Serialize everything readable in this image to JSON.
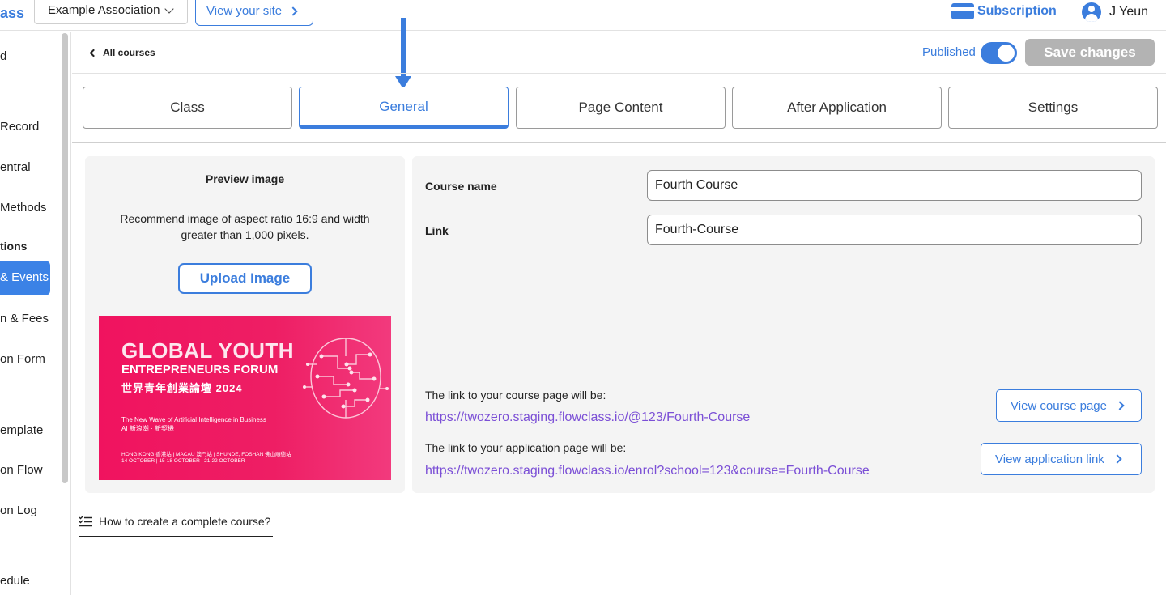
{
  "topbar": {
    "brand_fragment": "ass",
    "association": "Example Association",
    "view_site": "View your site",
    "subscription": "Subscription",
    "user_name": "J Yeun"
  },
  "sidebar": {
    "items": [
      {
        "label": "d"
      },
      {
        "label": "Record"
      },
      {
        "label": "entral"
      },
      {
        "label": "Methods"
      },
      {
        "label": "tions"
      },
      {
        "label": "& Events"
      },
      {
        "label": "n & Fees"
      },
      {
        "label": "on Form"
      },
      {
        "label": "emplate"
      },
      {
        "label": "on Flow"
      },
      {
        "label": "on Log"
      },
      {
        "label": "edule"
      }
    ]
  },
  "header": {
    "back_label": "All courses",
    "published_label": "Published",
    "published_on": true,
    "save_label": "Save changes"
  },
  "tabs": [
    {
      "label": "Class"
    },
    {
      "label": "General"
    },
    {
      "label": "Page Content"
    },
    {
      "label": "After Application"
    },
    {
      "label": "Settings"
    }
  ],
  "active_tab": "General",
  "preview": {
    "title": "Preview image",
    "description": "Recommend image of aspect ratio 16:9 and width greater than 1,000 pixels.",
    "upload_label": "Upload Image",
    "banner": {
      "line1": "GLOBAL YOUTH",
      "line2": "ENTREPRENEURS FORUM",
      "line3": "世界青年創業論壇 2024",
      "line4": "The New Wave of Artificial Intelligence in Business",
      "line5": "AI 新浪潮 · 新契機",
      "line6": "HONG KONG 香港站  |  MACAU 澳門站  |  SHUNDE, FOSHAN 佛山順德站",
      "line7": "14 OCTOBER        |  15-18 OCTOBER  |  21-22 OCTOBER"
    }
  },
  "form": {
    "course_name_label": "Course name",
    "course_name_value": "Fourth Course",
    "link_label": "Link",
    "link_value": "Fourth-Course",
    "course_page_text": "The link to your course page will be:",
    "course_page_url": "https://twozero.staging.flowclass.io/@123/Fourth-Course",
    "view_course_label": "View course page",
    "application_text": "The link to your application page will be:",
    "application_url": "https://twozero.staging.flowclass.io/enrol?school=123&course=Fourth-Course",
    "view_application_label": "View application link"
  },
  "help": {
    "label": "How to create a complete course?"
  },
  "colors": {
    "accent": "#3b7ddd",
    "link": "#7b4fd6",
    "save_disabled": "#b3b3b3",
    "banner": "#f0135f"
  }
}
